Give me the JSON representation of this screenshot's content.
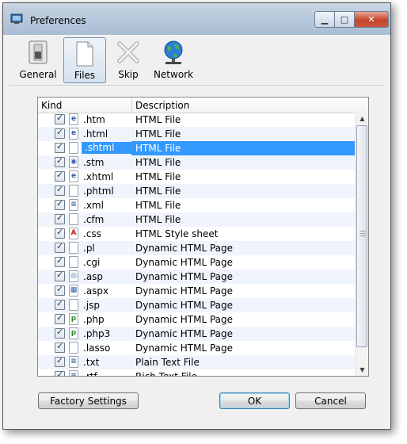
{
  "window": {
    "title": "Preferences"
  },
  "toolbar": {
    "general": "General",
    "files": "Files",
    "skip": "Skip",
    "network": "Network"
  },
  "list": {
    "columns": {
      "kind": "Kind",
      "description": "Description"
    },
    "selected_index": 2,
    "rows": [
      {
        "ext": ".htm",
        "desc": "HTML File",
        "icon": "ie-icon"
      },
      {
        "ext": ".html",
        "desc": "HTML File",
        "icon": "ie-icon"
      },
      {
        "ext": ".shtml",
        "desc": "HTML File",
        "icon": "blank-file-icon"
      },
      {
        "ext": ".stm",
        "desc": "HTML File",
        "icon": "html-file-icon"
      },
      {
        "ext": ".xhtml",
        "desc": "HTML File",
        "icon": "ie-icon"
      },
      {
        "ext": ".phtml",
        "desc": "HTML File",
        "icon": "blank-file-icon"
      },
      {
        "ext": ".xml",
        "desc": "HTML File",
        "icon": "xml-icon"
      },
      {
        "ext": ".cfm",
        "desc": "HTML File",
        "icon": "blank-file-icon"
      },
      {
        "ext": ".css",
        "desc": "HTML Style sheet",
        "icon": "css-icon"
      },
      {
        "ext": ".pl",
        "desc": "Dynamic HTML Page",
        "icon": "blank-file-icon"
      },
      {
        "ext": ".cgi",
        "desc": "Dynamic HTML Page",
        "icon": "blank-file-icon"
      },
      {
        "ext": ".asp",
        "desc": "Dynamic HTML Page",
        "icon": "asp-icon"
      },
      {
        "ext": ".aspx",
        "desc": "Dynamic HTML Page",
        "icon": "aspx-icon"
      },
      {
        "ext": ".jsp",
        "desc": "Dynamic HTML Page",
        "icon": "blank-file-icon"
      },
      {
        "ext": ".php",
        "desc": "Dynamic HTML Page",
        "icon": "php-icon"
      },
      {
        "ext": ".php3",
        "desc": "Dynamic HTML Page",
        "icon": "php-icon"
      },
      {
        "ext": ".lasso",
        "desc": "Dynamic HTML Page",
        "icon": "blank-file-icon"
      },
      {
        "ext": ".txt",
        "desc": "Plain Text File",
        "icon": "text-file-icon"
      },
      {
        "ext": ".rtf",
        "desc": "Rich Text File",
        "icon": "rtf-icon"
      }
    ]
  },
  "buttons": {
    "factory": "Factory Settings",
    "ok": "OK",
    "cancel": "Cancel"
  }
}
